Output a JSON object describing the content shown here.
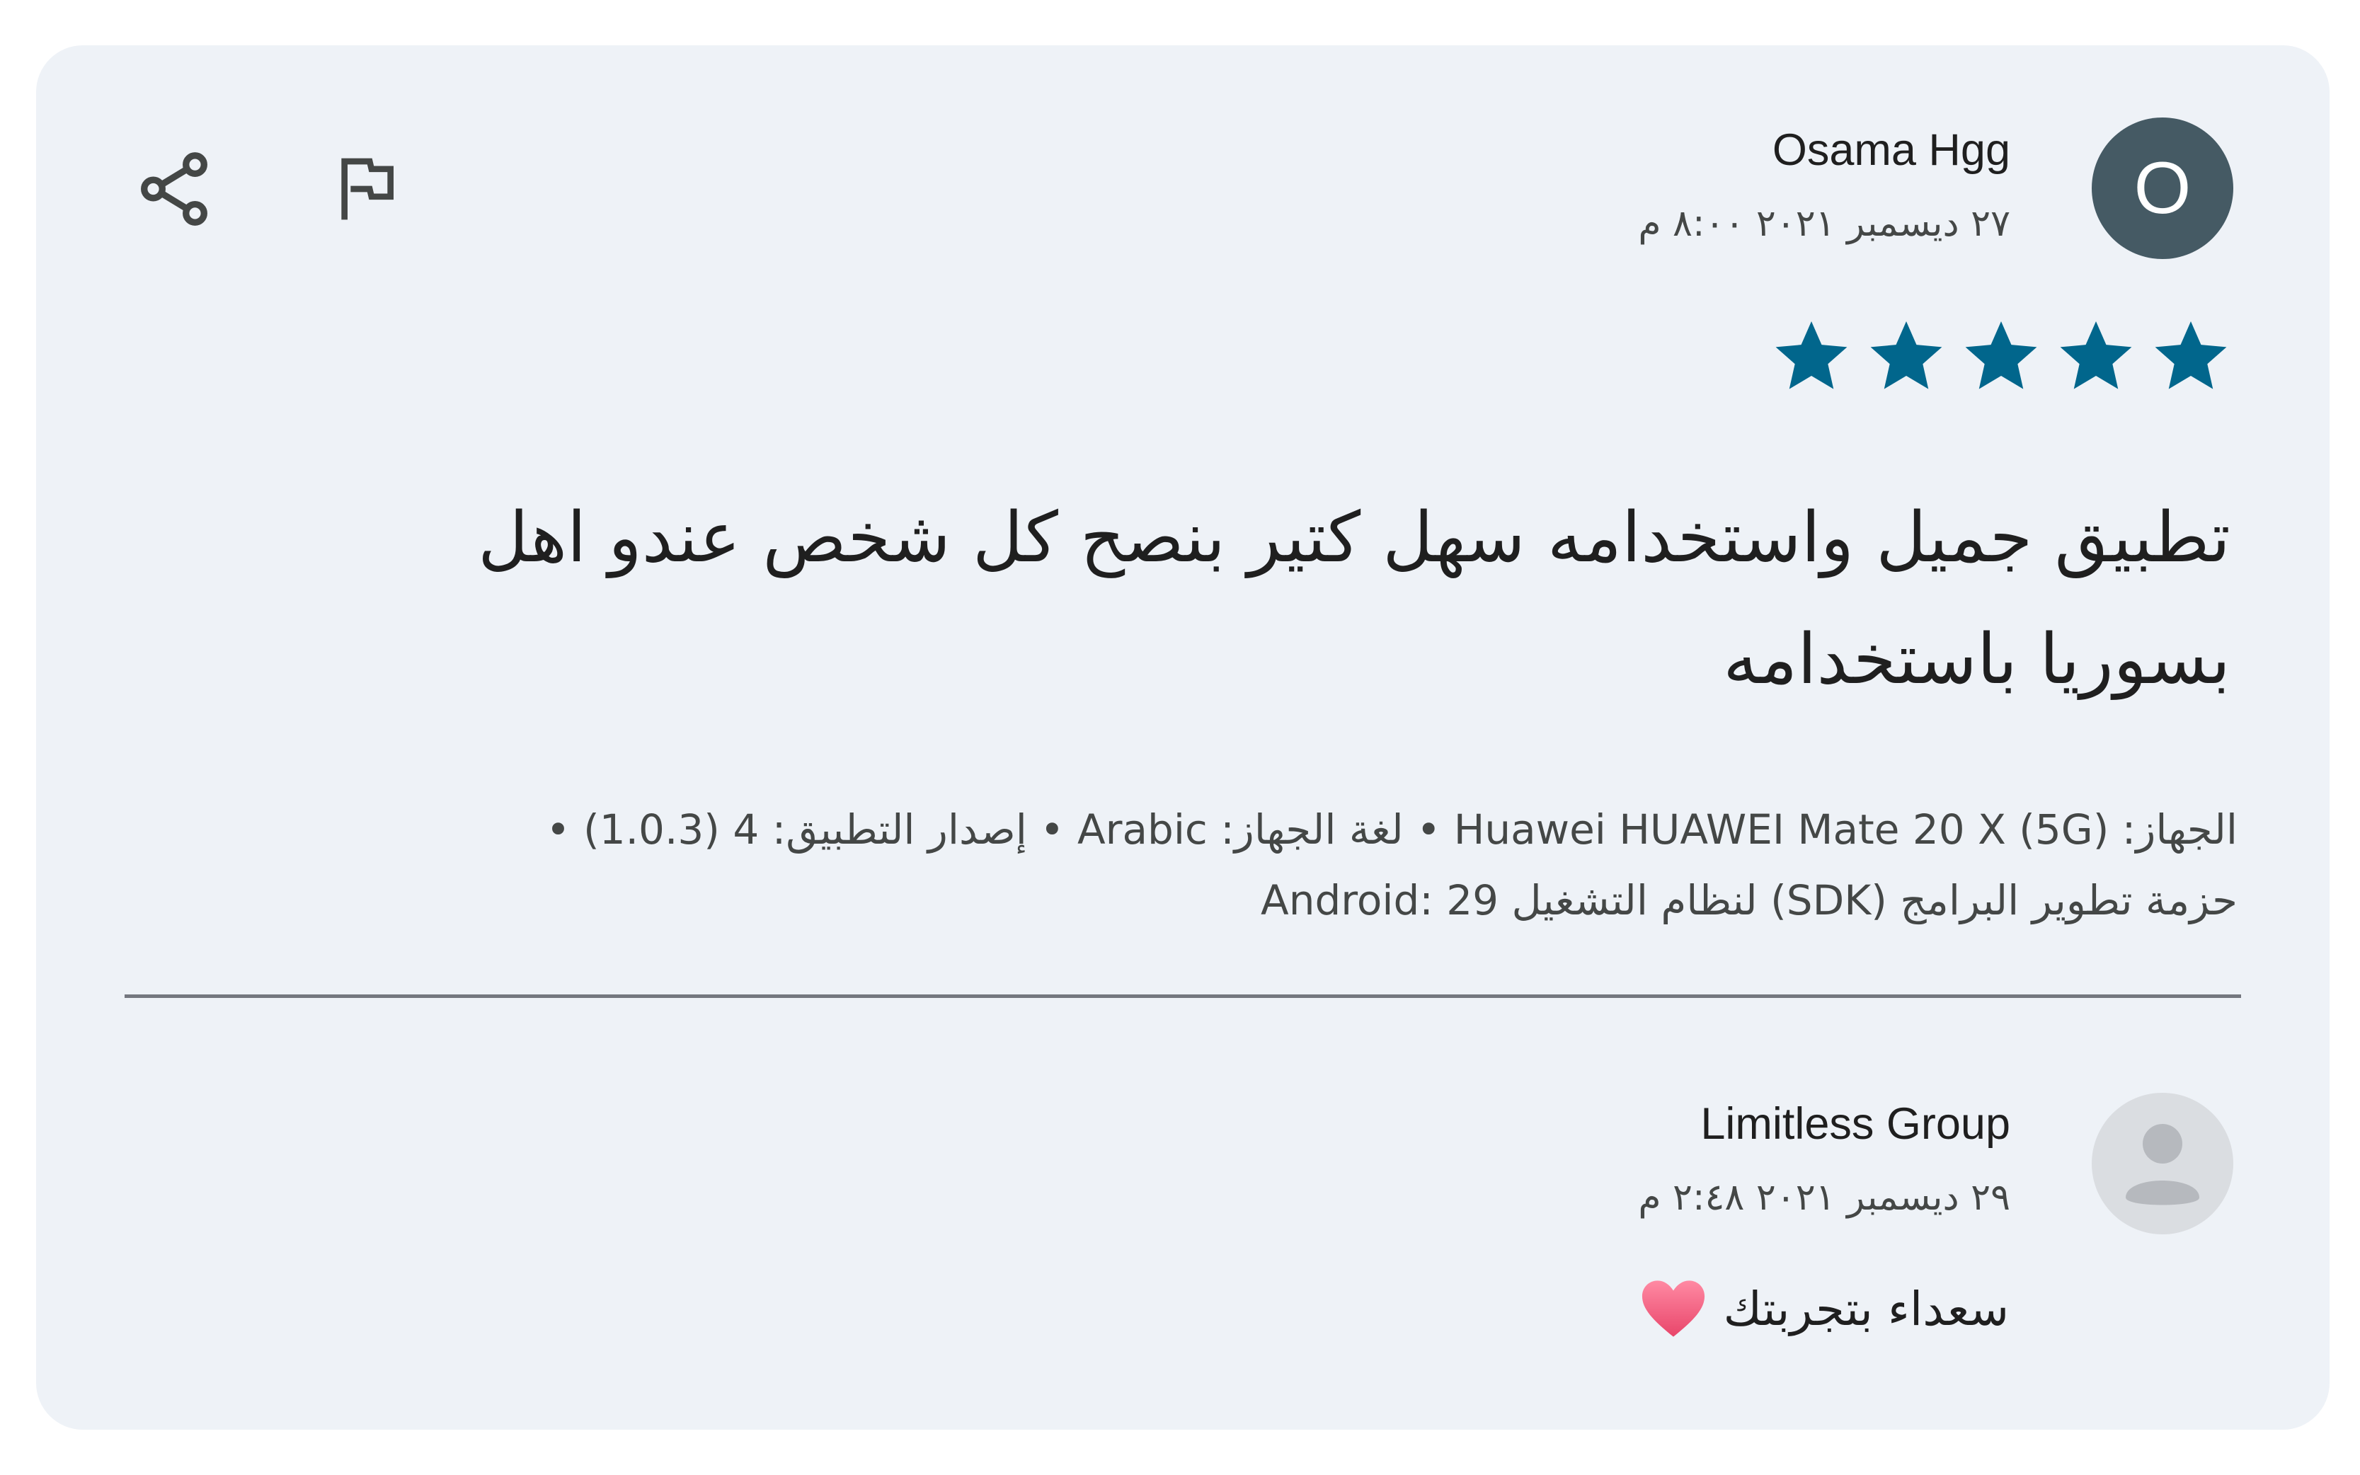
{
  "review": {
    "author_initial": "O",
    "author_name": "Osama Hgg",
    "date": "٢٧ ديسمبر ٢٠٢١ ٨:٠٠ م",
    "rating": 5,
    "rating_max": 5,
    "text": "تطبيق جميل واستخدامه سهل كتير بنصح كل شخص عندو اهل بسوريا باستخدامه",
    "device_info_line1": "الجهاز: Huawei HUAWEI Mate 20 X (5G) • لغة الجهاز: Arabic • إصدار التطبيق: 4 (1.0.3) •",
    "device_info_line2": "حزمة تطوير البرامج (SDK) لنظام التشغيل Android: 29"
  },
  "actions": {
    "share_icon": "share-icon",
    "flag_icon": "flag-icon"
  },
  "reply": {
    "author_name": "Limitless Group",
    "date": "٢٩ ديسمبر ٢٠٢١ ٢:٤٨ م",
    "text": "سعداء بتجربتك",
    "emoji_icon": "heart-icon"
  },
  "colors": {
    "card_background": "#eef2f7",
    "star_color": "#01668c",
    "avatar_main": "#455a64",
    "avatar_reply": "#dadde1",
    "divider": "#74777f",
    "heart": "#f0607f"
  }
}
